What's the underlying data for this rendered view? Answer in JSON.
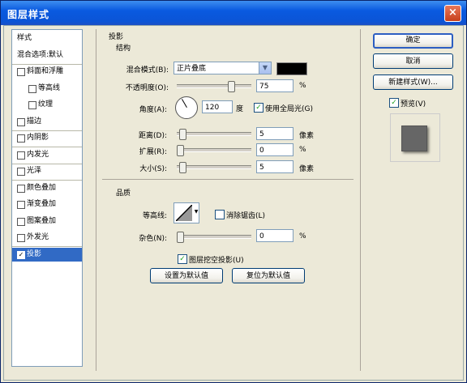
{
  "window": {
    "title": "图层样式",
    "close_glyph": "×"
  },
  "style_list": {
    "items": [
      {
        "label": "样式",
        "has_checkbox": false,
        "checked": false,
        "sub": false,
        "selected": false
      },
      {
        "label": "混合选项:默认",
        "has_checkbox": false,
        "checked": false,
        "sub": false,
        "selected": false
      },
      {
        "label": "斜面和浮雕",
        "has_checkbox": true,
        "checked": false,
        "sub": false,
        "selected": false
      },
      {
        "label": "等高线",
        "has_checkbox": true,
        "checked": false,
        "sub": true,
        "selected": false
      },
      {
        "label": "纹理",
        "has_checkbox": true,
        "checked": false,
        "sub": true,
        "selected": false
      },
      {
        "label": "描边",
        "has_checkbox": true,
        "checked": false,
        "sub": false,
        "selected": false
      },
      {
        "label": "内阴影",
        "has_checkbox": true,
        "checked": false,
        "sub": false,
        "selected": false
      },
      {
        "label": "内发光",
        "has_checkbox": true,
        "checked": false,
        "sub": false,
        "selected": false
      },
      {
        "label": "光泽",
        "has_checkbox": true,
        "checked": false,
        "sub": false,
        "selected": false
      },
      {
        "label": "颜色叠加",
        "has_checkbox": true,
        "checked": false,
        "sub": false,
        "selected": false
      },
      {
        "label": "渐变叠加",
        "has_checkbox": true,
        "checked": false,
        "sub": false,
        "selected": false
      },
      {
        "label": "图案叠加",
        "has_checkbox": true,
        "checked": false,
        "sub": false,
        "selected": false
      },
      {
        "label": "外发光",
        "has_checkbox": true,
        "checked": false,
        "sub": false,
        "selected": false
      },
      {
        "label": "投影",
        "has_checkbox": true,
        "checked": true,
        "sub": false,
        "selected": true
      }
    ]
  },
  "drop_shadow": {
    "heading": "投影",
    "structure_heading": "结构",
    "blend_mode": {
      "label": "混合模式(B):",
      "value": "正片叠底",
      "color": "#000000"
    },
    "opacity": {
      "label": "不透明度(O):",
      "value": "75",
      "unit": "%",
      "fraction": 0.75
    },
    "angle": {
      "label": "角度(A):",
      "value": "120",
      "unit": "度",
      "global_light_label": "使用全局光(G)",
      "global_light_checked": true
    },
    "distance": {
      "label": "距离(D):",
      "value": "5",
      "unit": "像素",
      "fraction": 0.03
    },
    "spread": {
      "label": "扩展(R):",
      "value": "0",
      "unit": "%",
      "fraction": 0.0
    },
    "size": {
      "label": "大小(S):",
      "value": "5",
      "unit": "像素",
      "fraction": 0.03
    }
  },
  "quality": {
    "heading": "品质",
    "contour_label": "等高线:",
    "antialias_label": "消除锯齿(L)",
    "antialias_checked": false,
    "noise": {
      "label": "杂色(N):",
      "value": "0",
      "unit": "%",
      "fraction": 0.0
    },
    "knockout_label": "图层挖空投影(U)",
    "knockout_checked": true,
    "make_default_label": "设置为默认值",
    "reset_default_label": "复位为默认值"
  },
  "buttons": {
    "ok": "确定",
    "cancel": "取消",
    "new_style": "新建样式(W)...",
    "preview_label": "预览(V)",
    "preview_checked": true
  },
  "check_glyph": "✓",
  "dropdown_glyph": "▼"
}
